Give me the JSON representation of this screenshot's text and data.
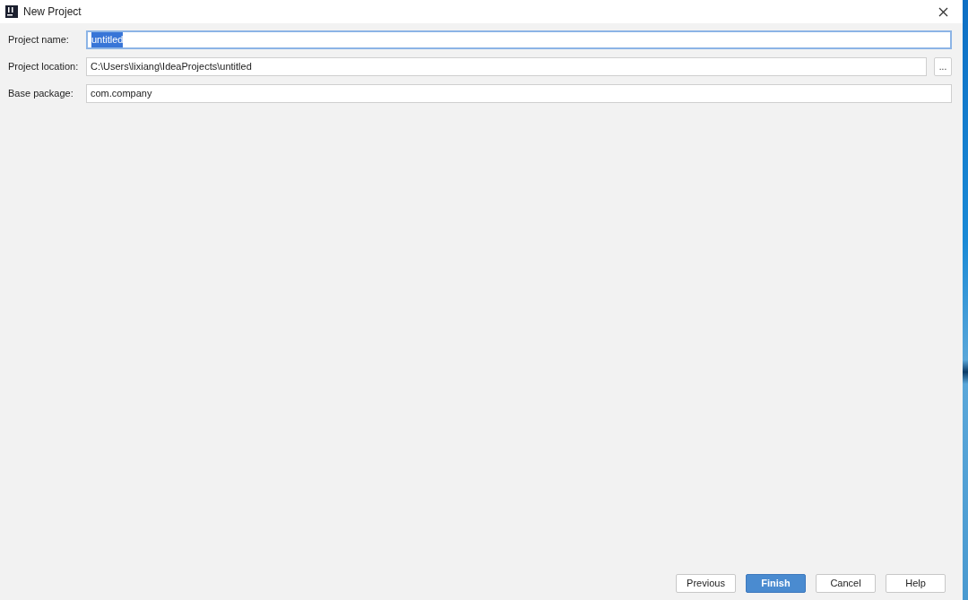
{
  "window": {
    "title": "New Project"
  },
  "fields": [
    {
      "label": "Project name:",
      "value": "untitled",
      "focused": true
    },
    {
      "label": "Project location:",
      "value": "C:\\Users\\lixiang\\IdeaProjects\\untitled",
      "focused": false,
      "browse_label": "..."
    },
    {
      "label": "Base package:",
      "value": "com.company",
      "focused": false
    }
  ],
  "buttons": [
    {
      "label": "Previous",
      "kind": "default"
    },
    {
      "label": "Finish",
      "kind": "primary"
    },
    {
      "label": "Cancel",
      "kind": "default"
    },
    {
      "label": "Help",
      "kind": "default"
    }
  ]
}
